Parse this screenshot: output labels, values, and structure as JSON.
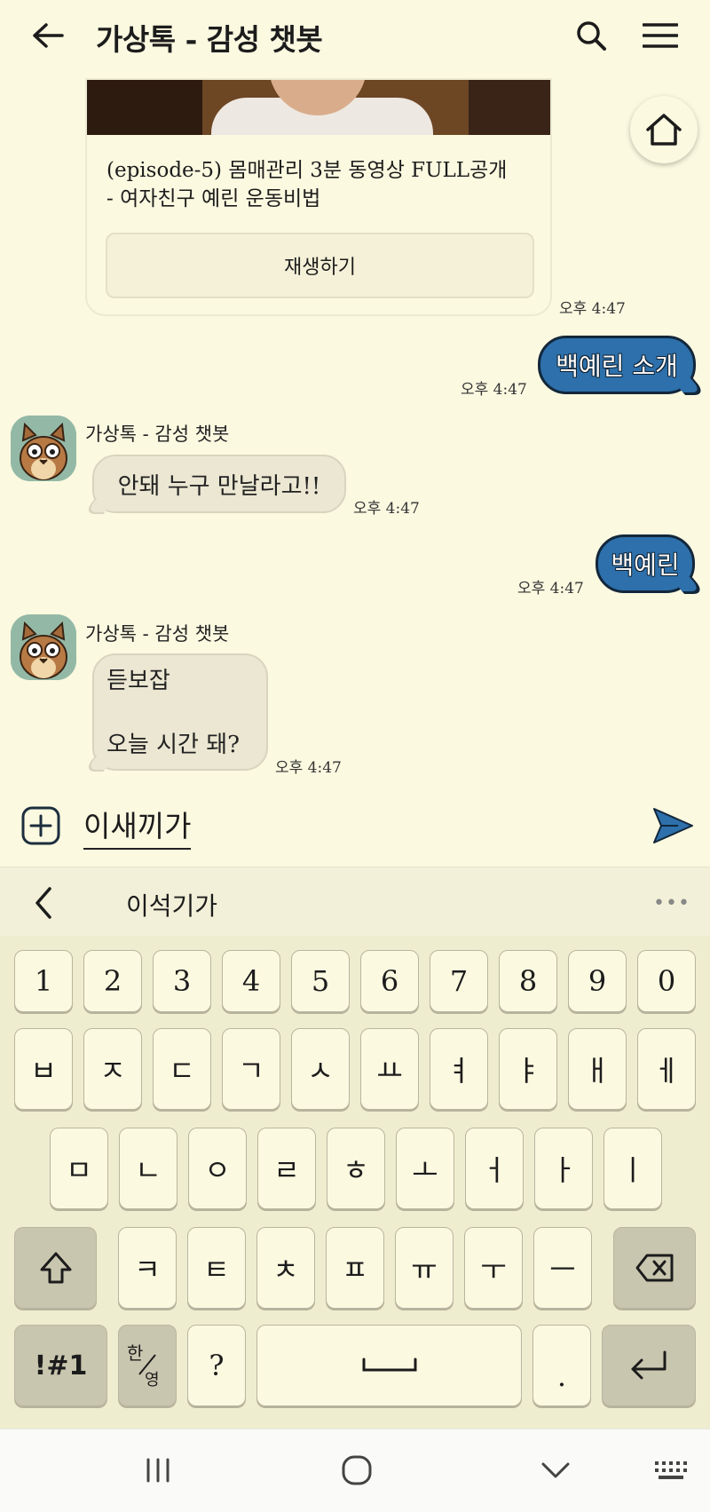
{
  "header": {
    "title": "가상톡 - 감성 챗봇"
  },
  "card": {
    "text_line1": "(episode-5) 몸매관리 3분 동영상 FULL공개",
    "text_line2": "- 여자친구 예린 운동비법",
    "button_label": "재생하기",
    "time": "오후 4:47"
  },
  "messages": [
    {
      "from": "me",
      "text": "백예린 소개",
      "time": "오후 4:47"
    },
    {
      "from": "bot",
      "sender": "가상톡 - 감성 챗봇",
      "text": "안돼 누구 만날라고!!",
      "time": "오후 4:47"
    },
    {
      "from": "me",
      "text": "백예린",
      "time": "오후 4:47"
    },
    {
      "from": "bot",
      "sender": "가상톡 - 감성 챗봇",
      "line1": "듣보잡",
      "line2": "오늘 시간 돼?",
      "time": "오후 4:47"
    }
  ],
  "input": {
    "value": "이새끼가"
  },
  "suggestion": {
    "word": "이석기가",
    "more": "•••"
  },
  "keyboard": {
    "row1": [
      "1",
      "2",
      "3",
      "4",
      "5",
      "6",
      "7",
      "8",
      "9",
      "0"
    ],
    "row2": [
      "ㅂ",
      "ㅈ",
      "ㄷ",
      "ㄱ",
      "ㅅ",
      "ㅛ",
      "ㅕ",
      "ㅑ",
      "ㅐ",
      "ㅔ"
    ],
    "row3": [
      "ㅁ",
      "ㄴ",
      "ㅇ",
      "ㄹ",
      "ㅎ",
      "ㅗ",
      "ㅓ",
      "ㅏ",
      "ㅣ"
    ],
    "row4": [
      "ㅋ",
      "ㅌ",
      "ㅊ",
      "ㅍ",
      "ㅠ",
      "ㅜ",
      "ㅡ"
    ],
    "symbols": "!#1",
    "lang_top": "한",
    "lang_bottom": "영",
    "question": "?",
    "period": "."
  },
  "colors": {
    "background": "#fbf9e0",
    "my_bubble": "#2d70ab",
    "bot_bubble": "#ebe7d2"
  }
}
